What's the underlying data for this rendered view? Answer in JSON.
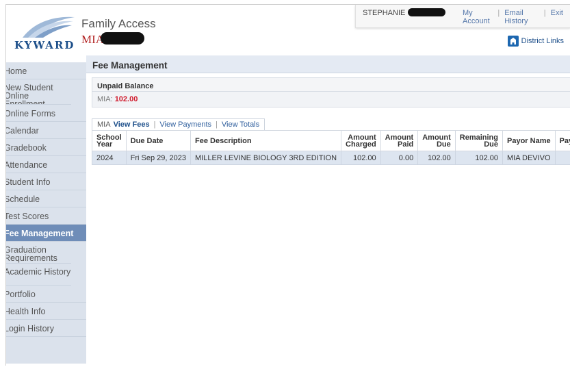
{
  "header": {
    "logo_text": "KYWARD",
    "app_title": "Family Access",
    "student_name": "MIA",
    "user_name": "STEPHANIE",
    "links": [
      "My Account",
      "Email History",
      "Exit"
    ],
    "district_links": "District Links"
  },
  "sidebar": {
    "items": [
      {
        "label": "Home",
        "lines": 1
      },
      {
        "label": "New Student Online Enrollment",
        "lines": 3
      },
      {
        "label": "Online Forms",
        "lines": 1
      },
      {
        "label": "Calendar",
        "lines": 1
      },
      {
        "label": "Gradebook",
        "lines": 1
      },
      {
        "label": "Attendance",
        "lines": 1
      },
      {
        "label": "Student Info",
        "lines": 1
      },
      {
        "label": "Schedule",
        "lines": 1
      },
      {
        "label": "Test Scores",
        "lines": 1
      },
      {
        "label": "Fee Management",
        "lines": 1,
        "active": true
      },
      {
        "label": "Graduation Requirements",
        "lines": 2
      },
      {
        "label": "Academic History",
        "lines": 2
      },
      {
        "label": "Portfolio",
        "lines": 1
      },
      {
        "label": "Health Info",
        "lines": 1
      },
      {
        "label": "Login History",
        "lines": 1
      }
    ]
  },
  "main": {
    "page_title": "Fee Management",
    "balance": {
      "header": "Unpaid Balance",
      "label": "MIA:",
      "amount": "102.00"
    },
    "tabs": {
      "prefix": "MIA",
      "items": [
        "View Fees",
        "View Payments",
        "View Totals"
      ],
      "active": "View Fees"
    },
    "table": {
      "columns": [
        "School Year",
        "Due Date",
        "Fee Description",
        "Amount Charged",
        "Amount Paid",
        "Amount Due",
        "Remaining Due",
        "Payor Name",
        "Pay Plan ID"
      ],
      "rows": [
        [
          "2024",
          "Fri Sep 29, 2023",
          "MILLER LEVINE BIOLOGY 3RD EDITION",
          "102.00",
          "0.00",
          "102.00",
          "102.00",
          "MIA DEVIVO",
          ""
        ]
      ]
    }
  },
  "colors": {
    "accent": "#6f8db8",
    "brand": "#1d4f8a",
    "balance_red": "#d0192b",
    "sidebar_bg": "#dbe2ec"
  }
}
